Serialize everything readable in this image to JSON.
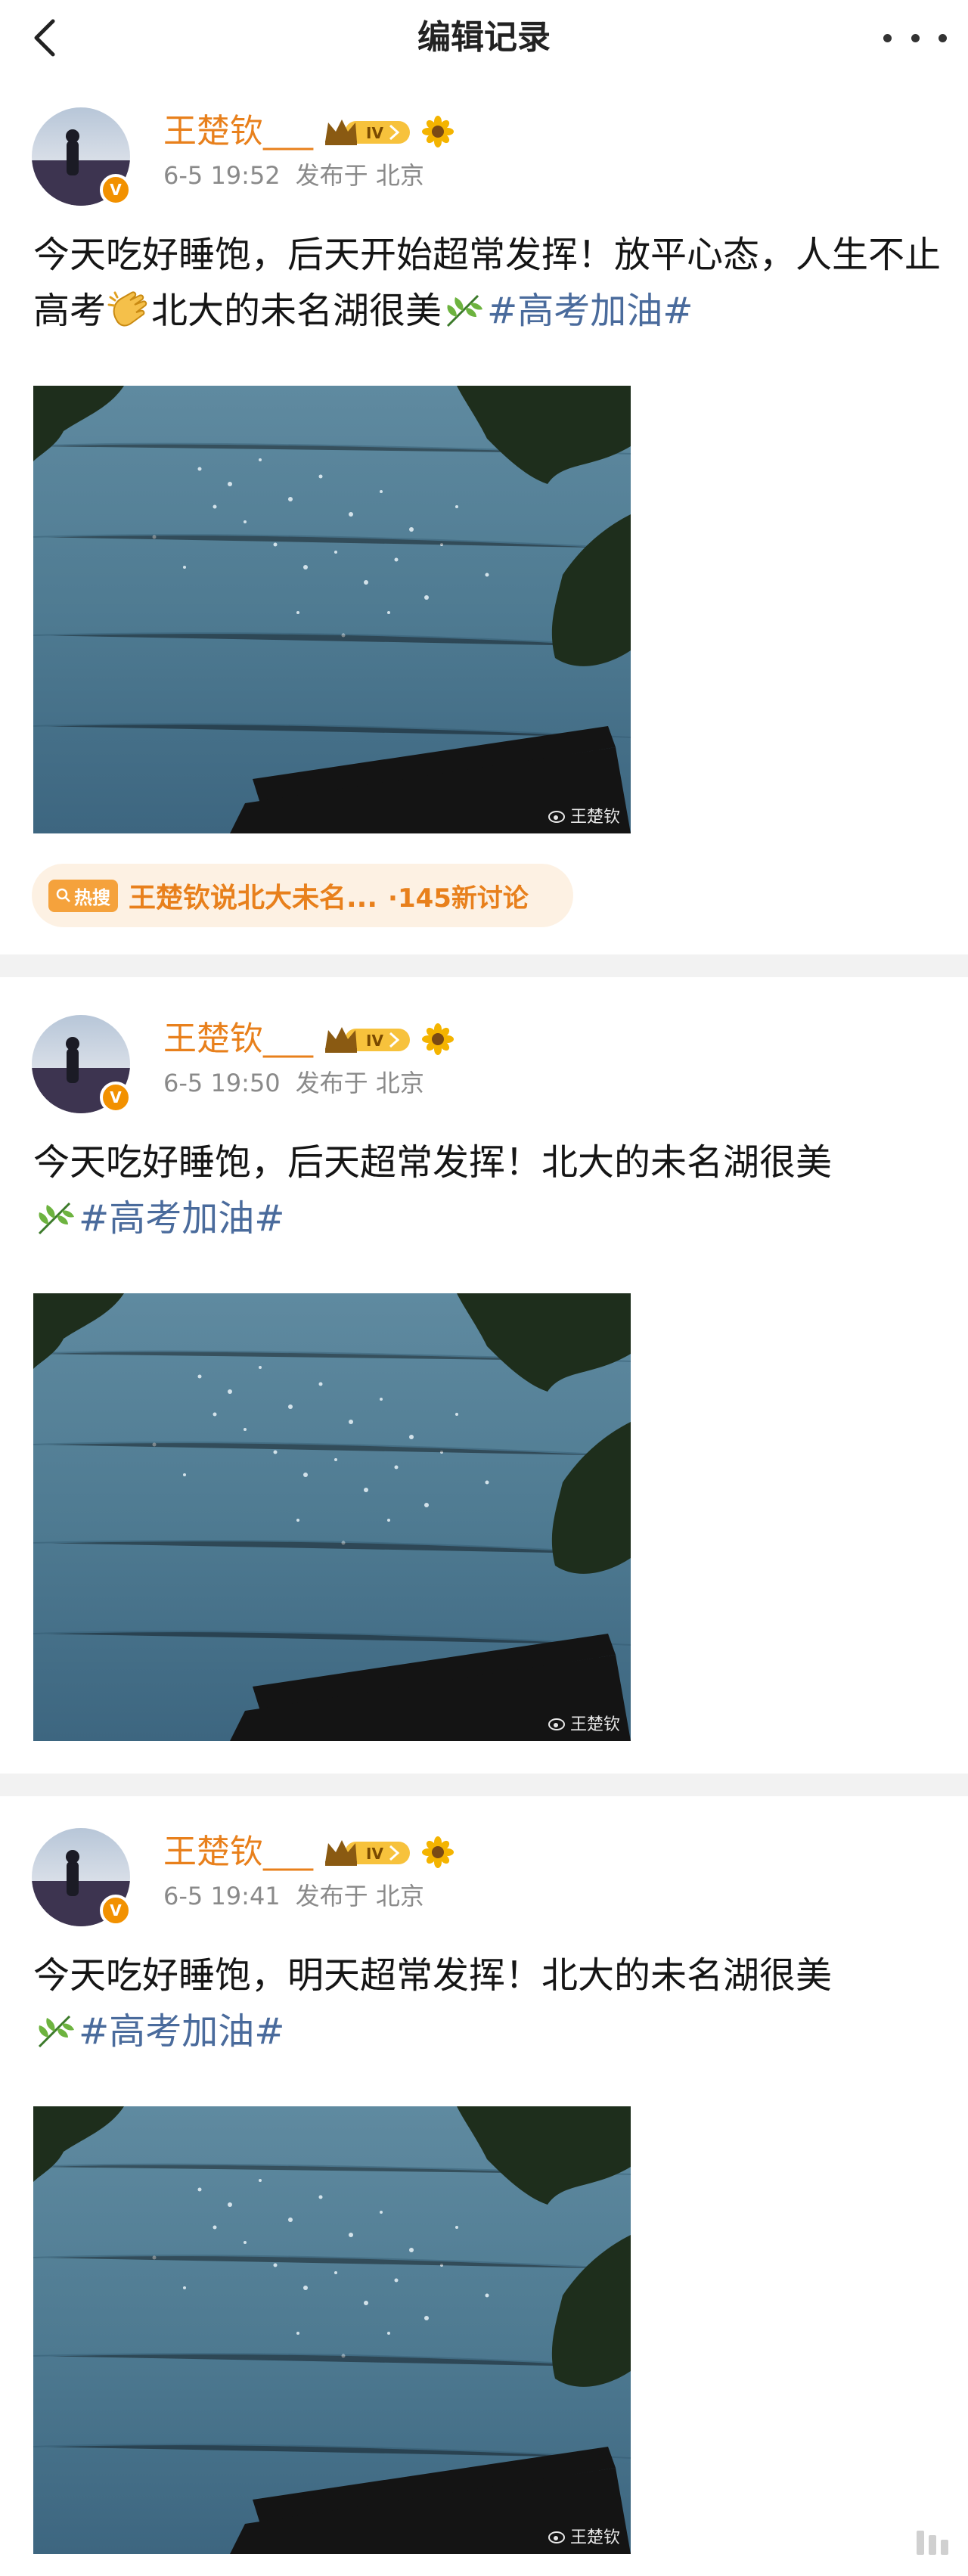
{
  "nav": {
    "title": "编辑记录",
    "back_icon": "chevron-left-icon",
    "more_icon": "more-dots-icon"
  },
  "posts": [
    {
      "username": "王楚钦___",
      "time": "6-5 19:52",
      "location": "发布于 北京",
      "text_before": "今天吃好睡饱，后天开始超常发挥！放平心态，人生不止高考",
      "text_middle": "北大的未名湖很美",
      "tag": "#高考加油#",
      "watermark": "王楚钦",
      "hot": {
        "tag": "热搜",
        "text": "王楚钦说北大未名...",
        "count": "·145新讨论"
      }
    },
    {
      "username": "王楚钦___",
      "time": "6-5 19:50",
      "location": "发布于 北京",
      "text_before": "今天吃好睡饱，后天超常发挥！北大的未名湖很美",
      "tag": "#高考加油#",
      "watermark": "王楚钦"
    },
    {
      "username": "王楚钦___",
      "time": "6-5 19:41",
      "location": "发布于 北京",
      "text_before": "今天吃好睡饱，明天超常发挥！北大的未名湖很美",
      "tag": "#高考加油#",
      "watermark": "王楚钦"
    }
  ],
  "colors": {
    "username": "#e8801c",
    "tag": "#4a6b9c",
    "meta": "#8a8a8a",
    "verified": "#f29100"
  }
}
